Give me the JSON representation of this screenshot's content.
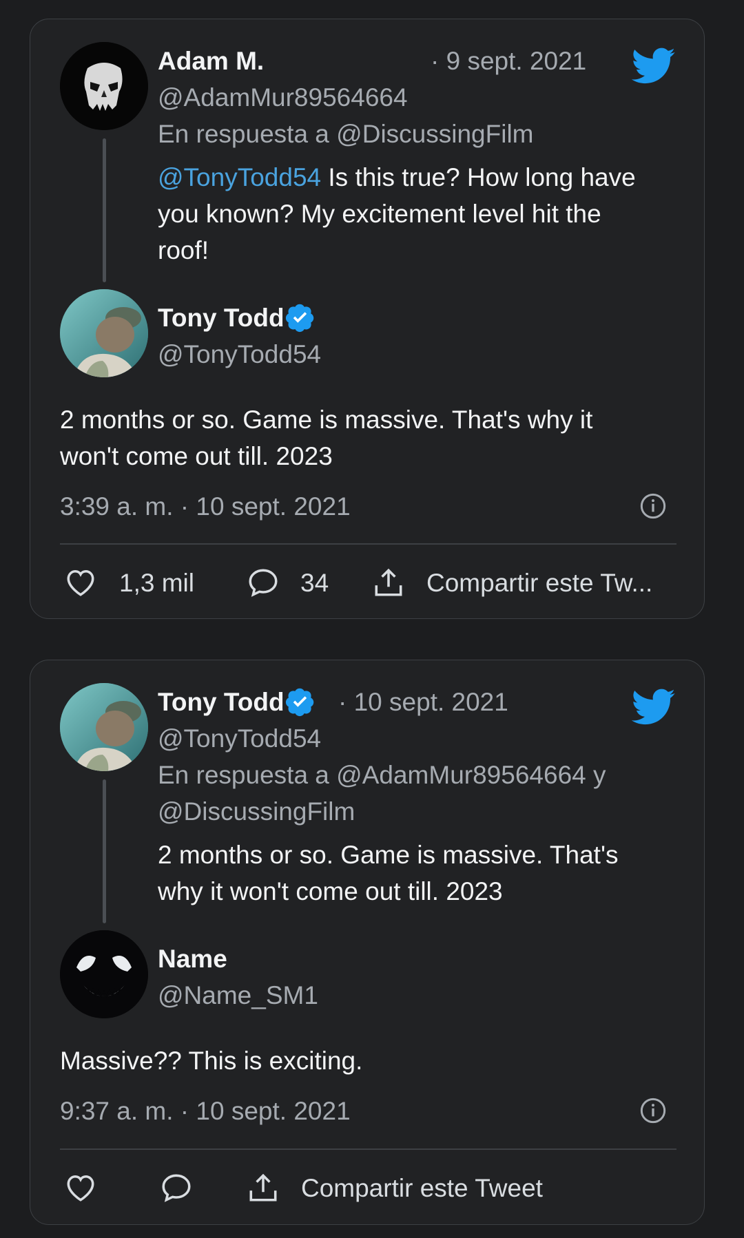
{
  "card1": {
    "parent": {
      "name": "Adam M.",
      "handle": "@AdamMur89564664",
      "date": "· 9 sept. 2021",
      "reply_to": "En respuesta a @DiscussingFilm",
      "mention": "@TonyTodd54",
      "text_l1": " Is this true?  How long have",
      "text_l2": "you known?  My excitement level hit the",
      "text_l3": "roof!"
    },
    "reply": {
      "name": "Tony Todd",
      "handle": "@TonyTodd54",
      "text_l1": "2 months or so. Game is massive.  That's why it",
      "text_l2": "won't come out till. 2023",
      "timestamp": "3:39 a. m. · 10 sept. 2021"
    },
    "actions": {
      "likes": "1,3 mil",
      "replies": "34",
      "share": "Compartir este Tw..."
    }
  },
  "card2": {
    "parent": {
      "name": "Tony Todd",
      "handle": "@TonyTodd54",
      "date": "· 10 sept. 2021",
      "reply_to_l1": "En respuesta a @AdamMur89564664 y",
      "reply_to_l2": "@DiscussingFilm",
      "text_l1": "2 months or so. Game is massive.  That's",
      "text_l2": "why it won't come out till. 2023"
    },
    "reply": {
      "name": "Name",
      "handle": "@Name_SM1",
      "text": "Massive?? This is exciting.",
      "timestamp": "9:37 a. m. · 10 sept. 2021"
    },
    "actions": {
      "share": "Compartir este Tweet"
    }
  },
  "colors": {
    "accent": "#1d9bf0",
    "mention": "#4aa3df",
    "background": "#1c1d1f",
    "card": "#212224"
  },
  "icons": [
    "twitter-bird-icon",
    "verified-badge-icon",
    "info-icon",
    "heart-icon",
    "reply-bubble-icon",
    "share-icon"
  ]
}
